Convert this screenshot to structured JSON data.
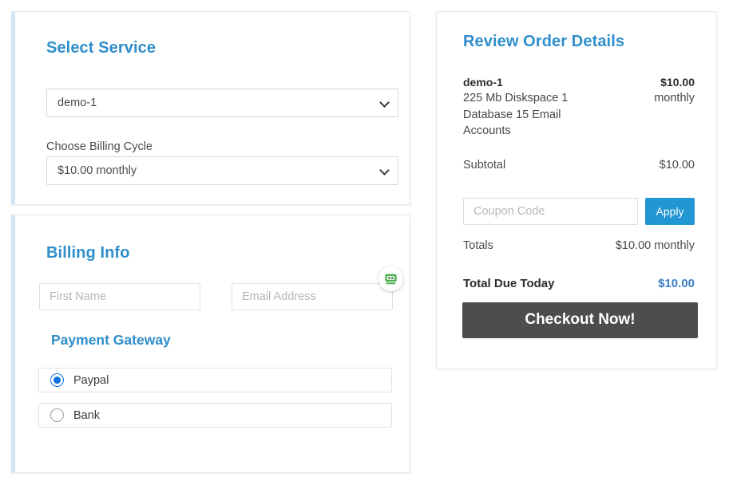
{
  "theme": {
    "heading_blue": "#2f8ecb",
    "accent_border_blue": "#cfe7f5",
    "apply_button_blue": "#2196d3",
    "checkout_button_gray": "#4d4d4d",
    "total_due_blue": "#3b7fc4",
    "radio_selected_blue": "#0a72dd",
    "page_background": "#ffffff",
    "card_border": "#e8e8e8"
  },
  "select_service": {
    "title": "Select Service",
    "service": {
      "selected": "demo-1",
      "options": [
        "demo-1"
      ]
    },
    "billing_cycle": {
      "label": "Choose Billing Cycle",
      "selected": "$10.00 monthly",
      "options": [
        "$10.00 monthly"
      ]
    },
    "chevron_icon": "chevron-down-icon"
  },
  "billing_info": {
    "title": "Billing Info",
    "first_name": {
      "placeholder": "First Name",
      "value": ""
    },
    "email": {
      "placeholder": "Email Address",
      "value": ""
    },
    "payment_gateway": {
      "title": "Payment Gateway",
      "options": [
        {
          "label": "Paypal",
          "selected": true
        },
        {
          "label": "Bank",
          "selected": false
        }
      ]
    },
    "extension_badge": {
      "icon": "robot-icon",
      "color": "#4caf50"
    }
  },
  "order_summary": {
    "title": "Review Order Details",
    "item": {
      "name": "demo-1",
      "description": "225 Mb Diskspace 1 Database 15 Email Accounts",
      "price": "$10.00",
      "cycle": "monthly"
    },
    "subtotal": {
      "label": "Subtotal",
      "value": "$10.00"
    },
    "coupon": {
      "placeholder": "Coupon Code",
      "value": "",
      "apply_label": "Apply"
    },
    "totals": {
      "label": "Totals",
      "value": "$10.00 monthly"
    },
    "total_due": {
      "label": "Total Due Today",
      "value": "$10.00"
    },
    "checkout_label": "Checkout Now!"
  }
}
